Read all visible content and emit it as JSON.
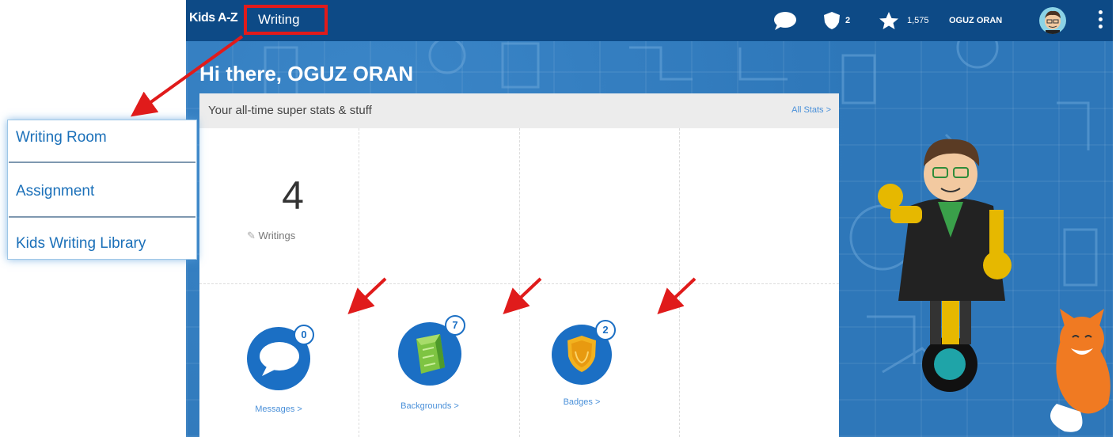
{
  "topbar": {
    "brand": "Kids A-Z",
    "active_tab": "Writing",
    "shields_count": "2",
    "stars_count": "1,575",
    "user_name": "OGUZ ORAN"
  },
  "greeting": "Hi there, OGUZ ORAN",
  "stats_panel": {
    "title": "Your all-time super stats & stuff",
    "all_stats_link": "All Stats >",
    "writings_count": "4",
    "writings_label": "Writings",
    "tiles": [
      {
        "label": "Messages >",
        "count": "0",
        "icon": "speech-bubble-icon"
      },
      {
        "label": "Backgrounds >",
        "count": "7",
        "icon": "backgrounds-icon"
      },
      {
        "label": "Badges >",
        "count": "2",
        "icon": "badge-shield-icon"
      }
    ]
  },
  "dropdown_menu": {
    "items": [
      "Writing Room",
      "Assignment",
      "Kids Writing Library"
    ]
  },
  "colors": {
    "topbar": "#0d4a86",
    "background": "#2e77b9",
    "accent_blue": "#1b6fc4",
    "annotation_red": "#e01b1b"
  }
}
